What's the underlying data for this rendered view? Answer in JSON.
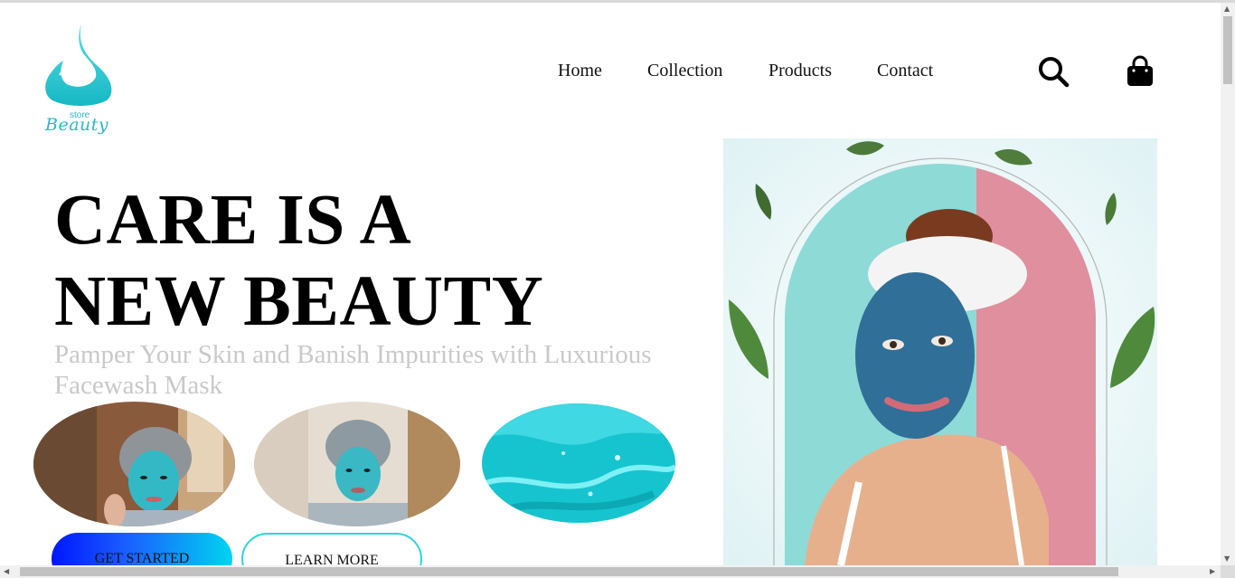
{
  "brand": {
    "store": "store",
    "name": "Beauty"
  },
  "nav": [
    {
      "label": "Home"
    },
    {
      "label": "Collection"
    },
    {
      "label": "Products"
    },
    {
      "label": "Contact"
    }
  ],
  "icons": {
    "search": "search-icon",
    "cart": "shopping-bag-icon"
  },
  "hero": {
    "line1": "CARE IS A",
    "line2": "NEW BEAUTY",
    "subtitle": "Pamper Your Skin and Banish Impurities with Luxurious Facewash Mask",
    "primary_button": "GET STARTED",
    "secondary_button": "LEARN MORE"
  },
  "colors": {
    "accent": "#2bb8c8",
    "gradient_start": "#0016ff",
    "gradient_end": "#00d4f0",
    "subtitle": "#c9c9c9"
  }
}
